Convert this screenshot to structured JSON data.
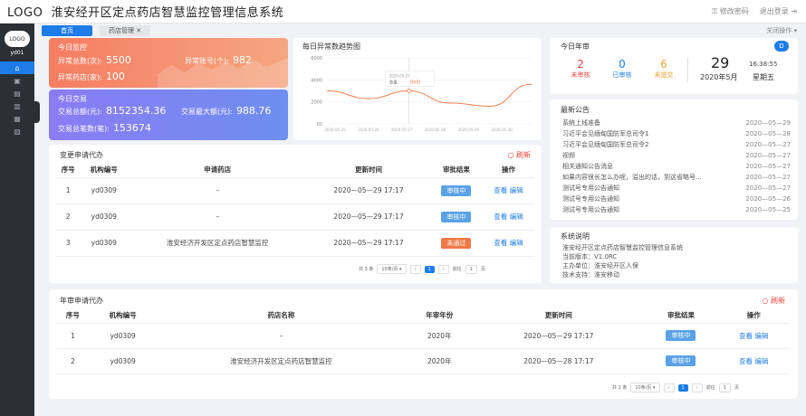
{
  "app": {
    "logo": "LOGO",
    "title": "淮安经开区定点药店智慧监控管理信息系统",
    "change_password": "修改密码",
    "logout": "退出登录"
  },
  "sidebar": {
    "avatar": "LOGO",
    "user_id": "yd01",
    "items": [
      "⌂",
      "▣",
      "▤",
      "▥",
      "▦",
      "▧"
    ]
  },
  "tabs": {
    "home": "首页",
    "store": "药店管理",
    "close_ops": "关闭操作"
  },
  "today_monitor": {
    "title": "今日监控",
    "abn_total_label": "异常总数(次):",
    "abn_total": "5500",
    "abn_account_label": "异常账号(个):",
    "abn_account": "982",
    "abn_store_label": "异常药店(家):",
    "abn_store": "100"
  },
  "today_trade": {
    "title": "今日交易",
    "total_label": "交易总额(元):",
    "total": "8152354.36",
    "max_label": "交易最大额(元):",
    "max": "988.76",
    "count_label": "交易总笔数(笔):",
    "count": "153674"
  },
  "chart_data": {
    "type": "line",
    "title": "每日异常数趋势图",
    "x": [
      "2020-05-25",
      "2020-05-26",
      "2020-05-27",
      "2020-05-28",
      "2020-05-29",
      "2020-05-30"
    ],
    "values": [
      3000,
      2300,
      3000,
      1900,
      1600,
      3600
    ],
    "ylim": [
      0,
      6000
    ],
    "yticks": [
      "6000",
      "4000",
      "2000",
      "00"
    ],
    "tooltip": {
      "date": "2020-05-27",
      "label": "总量",
      "value": "3000"
    },
    "color": "#f47e4b"
  },
  "annual": {
    "title": "今日年审",
    "avatar": "D",
    "pending_num": "2",
    "pending_label": "未审核",
    "done_num": "0",
    "done_label": "已审核",
    "unsubmitted_num": "6",
    "unsubmitted_label": "未提交",
    "day": "29",
    "time": "16:38:55",
    "date": "2020年5月",
    "weekday": "星期五"
  },
  "notices": {
    "title": "最新公告",
    "items": [
      {
        "t": "系统上线准备",
        "d": "2020—05—29"
      },
      {
        "t": "习近平会见缅甸国防军总司令1",
        "d": "2020—05—28"
      },
      {
        "t": "习近平会见缅甸国防军总司令2",
        "d": "2020—05—27"
      },
      {
        "t": "视频",
        "d": "2020—05—27"
      },
      {
        "t": "相关通知公告消息",
        "d": "2020—05—27"
      },
      {
        "t": "如果内容很长怎么办呢，溢出的话，到这省略号...",
        "d": "2020—05—27"
      },
      {
        "t": "测试号专用公告通知",
        "d": "2020—05—27"
      },
      {
        "t": "测试号专用公告通知",
        "d": "2020—05—26"
      },
      {
        "t": "测试号专用公告通知",
        "d": "2020—05—25"
      }
    ]
  },
  "sysinfo": {
    "title": "系统说明",
    "line1": "淮安经开区定点药店智慧监控管理信息系统",
    "line2": "当前版本：V1.0RC",
    "line3": "主办单位：淮安经开区人保",
    "line4": "技术支持：淮安移动"
  },
  "change_req": {
    "title": "变更申请代办",
    "refresh": "刷新",
    "headers": [
      "序号",
      "机构编号",
      "申请药店",
      "更新时间",
      "审批结果",
      "操作"
    ],
    "rows": [
      {
        "no": "1",
        "org": "yd0309",
        "store": "–",
        "time": "2020—05—29 17:17",
        "status": "审核中",
        "color": "#5aa2e6"
      },
      {
        "no": "2",
        "org": "yd0309",
        "store": "–",
        "time": "2020—05—29 17:17",
        "status": "审核中",
        "color": "#5aa2e6"
      },
      {
        "no": "3",
        "org": "yd0309",
        "store": "淮安经济开发区定点药店智慧监控",
        "time": "2020—05—29 17:17",
        "status": "未通过",
        "color": "#f07a47"
      }
    ],
    "view": "查看",
    "edit": "编辑",
    "pager": {
      "total": "共 3 条",
      "size": "10条/页",
      "page": "1",
      "goto": "前往",
      "goto_val": "1",
      "unit": "页"
    }
  },
  "annual_req": {
    "title": "年审申请代办",
    "refresh": "刷新",
    "headers": [
      "序号",
      "机构编号",
      "药店名称",
      "年审年份",
      "更新时间",
      "审批结果",
      "操作"
    ],
    "rows": [
      {
        "no": "1",
        "org": "yd0309",
        "store": "–",
        "year": "2020年",
        "time": "2020—05—29 17:17",
        "status": "审核中"
      },
      {
        "no": "2",
        "org": "yd0309",
        "store": "淮安经济开发区定点药店智慧监控",
        "year": "2020年",
        "time": "2020—05—28 17:17",
        "status": "审核中"
      }
    ],
    "view": "查看",
    "edit": "编辑",
    "pager": {
      "total": "共 2 条",
      "size": "10条/页",
      "page": "1",
      "goto": "前往",
      "goto_val": "1",
      "unit": "页"
    }
  }
}
